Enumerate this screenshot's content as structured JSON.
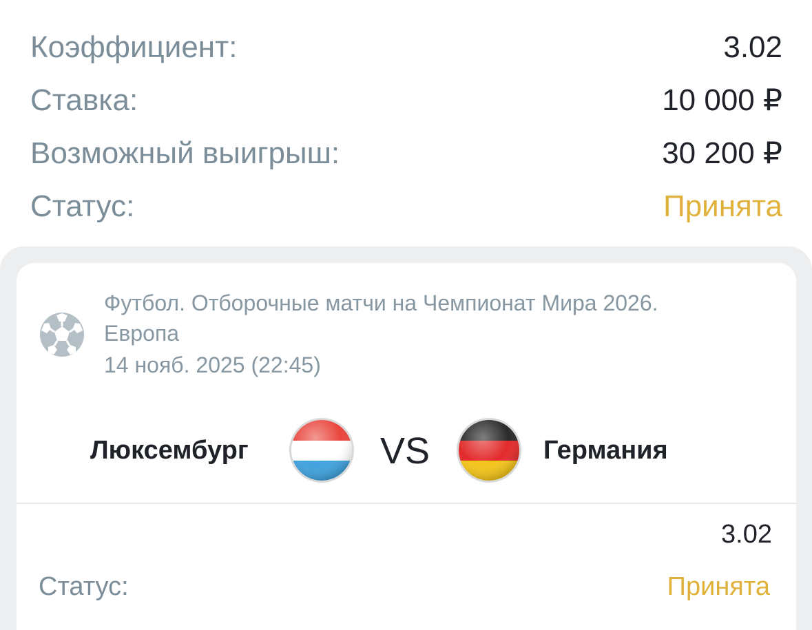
{
  "summary": {
    "odds_label": "Коэффициент:",
    "odds_value": "3.02",
    "stake_label": "Ставка:",
    "stake_value": "10 000 ₽",
    "win_label": "Возможный выигрыш:",
    "win_value": "30 200 ₽",
    "status_label": "Статус:",
    "status_value": "Принята"
  },
  "event": {
    "sport_icon": "soccer-ball-icon",
    "tournament": "Футбол. Отборочные матчи на Чемпионат Мира 2026. Европа",
    "datetime": "14 нояб. 2025 (22:45)",
    "home_team": "Люксембург",
    "home_flag": "luxembourg-flag-icon",
    "vs": "VS",
    "away_team": "Германия",
    "away_flag": "germany-flag-icon",
    "odds": "3.02",
    "status_label": "Статус:",
    "status_value": "Принята"
  },
  "colors": {
    "label": "#7b8d98",
    "value": "#1f2228",
    "status_accepted": "#e0b23b",
    "panel_bg": "#eceef0"
  }
}
